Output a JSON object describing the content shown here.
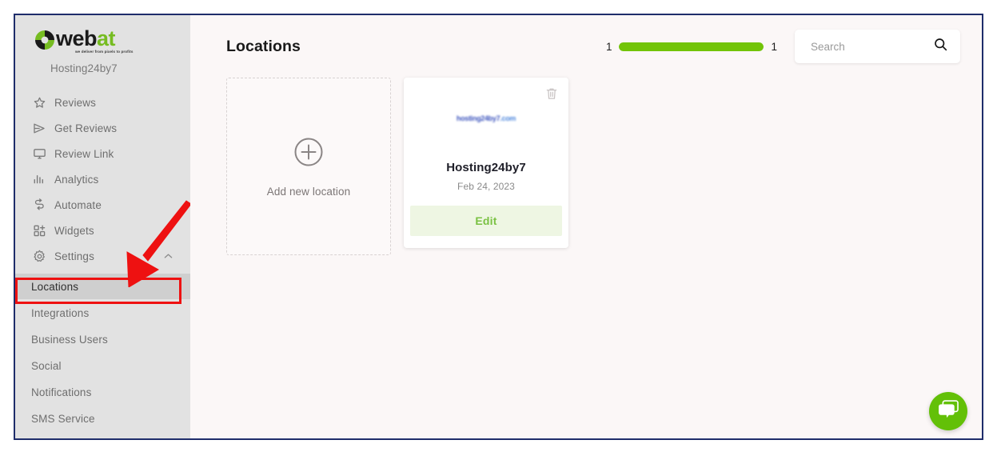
{
  "brand": {
    "word_dark": "web",
    "word_accent": "at",
    "tagline": "we deliver from pixels to profits",
    "account_name": "Hosting24by7"
  },
  "sidebar": {
    "nav": [
      {
        "label": "Reviews",
        "icon": "star-icon"
      },
      {
        "label": "Get Reviews",
        "icon": "paper-plane-icon"
      },
      {
        "label": "Review Link",
        "icon": "monitor-icon"
      },
      {
        "label": "Analytics",
        "icon": "bar-chart-icon"
      },
      {
        "label": "Automate",
        "icon": "automate-icon"
      },
      {
        "label": "Widgets",
        "icon": "widgets-plus-icon"
      },
      {
        "label": "Settings",
        "icon": "gear-icon",
        "chevron": "chevron-up-icon"
      }
    ],
    "subnav": [
      {
        "label": "Locations",
        "active": true
      },
      {
        "label": "Integrations",
        "active": false
      },
      {
        "label": "Business Users",
        "active": false
      },
      {
        "label": "Social",
        "active": false
      },
      {
        "label": "Notifications",
        "active": false
      },
      {
        "label": "SMS Service",
        "active": false
      }
    ]
  },
  "header": {
    "title": "Locations",
    "progress": {
      "current": "1",
      "total": "1",
      "percent": 100,
      "fill_color": "#72c408"
    },
    "search": {
      "placeholder": "Search",
      "value": "",
      "icon": "search-icon"
    }
  },
  "main": {
    "add_card": {
      "label": "Add new location",
      "icon": "plus-circle-icon"
    },
    "locations": [
      {
        "logo_text": "hosting24by7",
        "logo_suffix": ".com",
        "name": "Hosting24by7",
        "date": "Feb 24, 2023",
        "edit_label": "Edit",
        "delete_icon": "trash-icon"
      }
    ]
  },
  "chat_widget": {
    "icon": "chat-bubbles-icon",
    "color": "#63c008"
  },
  "annotations": {
    "highlight_target": "Locations",
    "arrow_color": "#ee1111",
    "box_color": "#ee1111"
  }
}
